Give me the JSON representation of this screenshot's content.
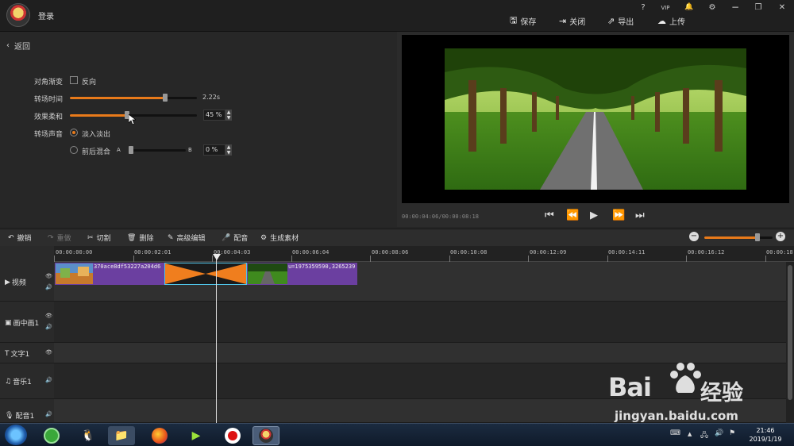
{
  "app": {
    "login": "登录"
  },
  "window_controls": {
    "help": "?",
    "vip": "VIP",
    "bell": "🔔",
    "settings": "⚙",
    "restore": "❐",
    "close": "✕"
  },
  "top_actions": [
    {
      "icon": "🖫",
      "label": "保存"
    },
    {
      "icon": "⇥",
      "label": "关闭"
    },
    {
      "icon": "⇗",
      "label": "导出"
    },
    {
      "icon": "☁",
      "label": "上传"
    }
  ],
  "panel": {
    "back": "返回",
    "diagonal_label": "对角渐变",
    "reverse_label": "反向",
    "duration_label": "转场时间",
    "duration_value": "2.22s",
    "duration_level": 0.75,
    "soft_label": "效果柔和",
    "soft_value": "45 %",
    "soft_level": 0.45,
    "sound_label": "转场声音",
    "fade_label": "淡入淡出",
    "mix_label": "前后混合",
    "a_label": "A",
    "b_label": "B",
    "mix_value": "0 %",
    "mix_level": 0.0
  },
  "preview": {
    "timecode": "00:00:04:06/00:00:08:18"
  },
  "toolbar": {
    "undo": "撤销",
    "redo": "重做",
    "cut": "切割",
    "delete": "删除",
    "advanced": "高级编辑",
    "dub": "配音",
    "generate": "生成素材",
    "zoom_level": 0.78
  },
  "ruler": [
    "00:00:00:00",
    "00:00:02:01",
    "00:00:04:03",
    "00:00:06:04",
    "00:00:08:06",
    "00:00:10:08",
    "00:00:12:09",
    "00:00:14:11",
    "00:00:16:12",
    "00:00:18:"
  ],
  "tracks": {
    "video": "视频",
    "pip": "画中画1",
    "text": "文字1",
    "music": "音乐1",
    "dub": "配音1",
    "clip1_name": "370ace8df53227a204d6",
    "clip2_name": "u=1975359590,3265239"
  },
  "taskbar": {
    "time": "21:46",
    "date": "2019/1/19"
  },
  "watermark": {
    "brand": "Bai",
    "brand2": "经验",
    "url": "jingyan.baidu.com"
  },
  "colors": {
    "accent": "#e87a1a",
    "clip": "#6b3fa0",
    "transition": "#f07e1e"
  }
}
